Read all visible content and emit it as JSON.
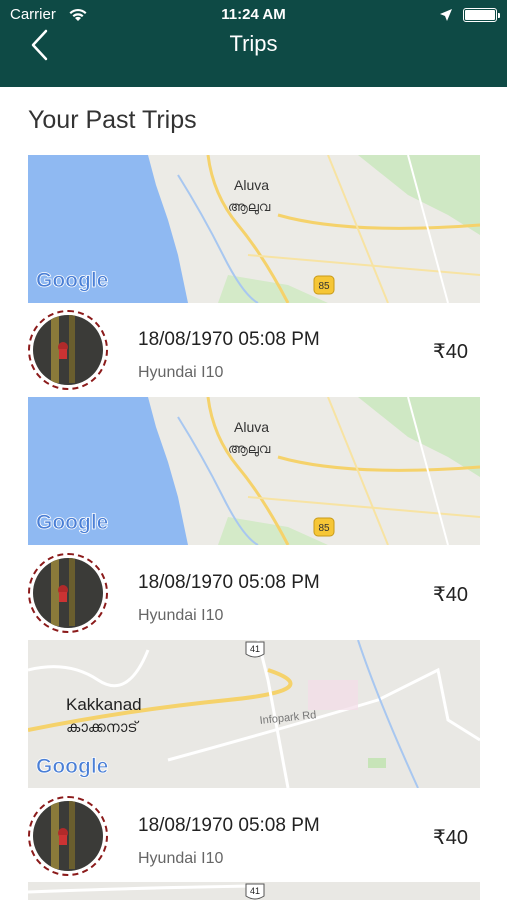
{
  "status_bar": {
    "carrier": "Carrier",
    "time": "11:24 AM"
  },
  "header": {
    "title": "Trips",
    "back_icon": "chevron-left-icon",
    "background": "#0e4a45"
  },
  "section_title": "Your Past Trips",
  "maps": [
    {
      "place": "Aluva",
      "place_local": "ആലുവ",
      "road_shield": "85",
      "logo": "Google"
    },
    {
      "place": "Aluva",
      "place_local": "ആലുവ",
      "road_shield": "85",
      "logo": "Google"
    },
    {
      "place": "Kakkanad",
      "place_local": "കാക്കനാട്",
      "road_label": "Infopark Rd",
      "road_shield": "41",
      "logo": "Google"
    },
    {
      "road_shield": "41"
    }
  ],
  "trips": [
    {
      "datetime": "18/08/1970 05:08 PM",
      "car": "Hyundai I10",
      "price": "₹40"
    },
    {
      "datetime": "18/08/1970 05:08 PM",
      "car": "Hyundai I10",
      "price": "₹40"
    },
    {
      "datetime": "18/08/1970 05:08 PM",
      "car": "Hyundai I10",
      "price": "₹40"
    }
  ]
}
